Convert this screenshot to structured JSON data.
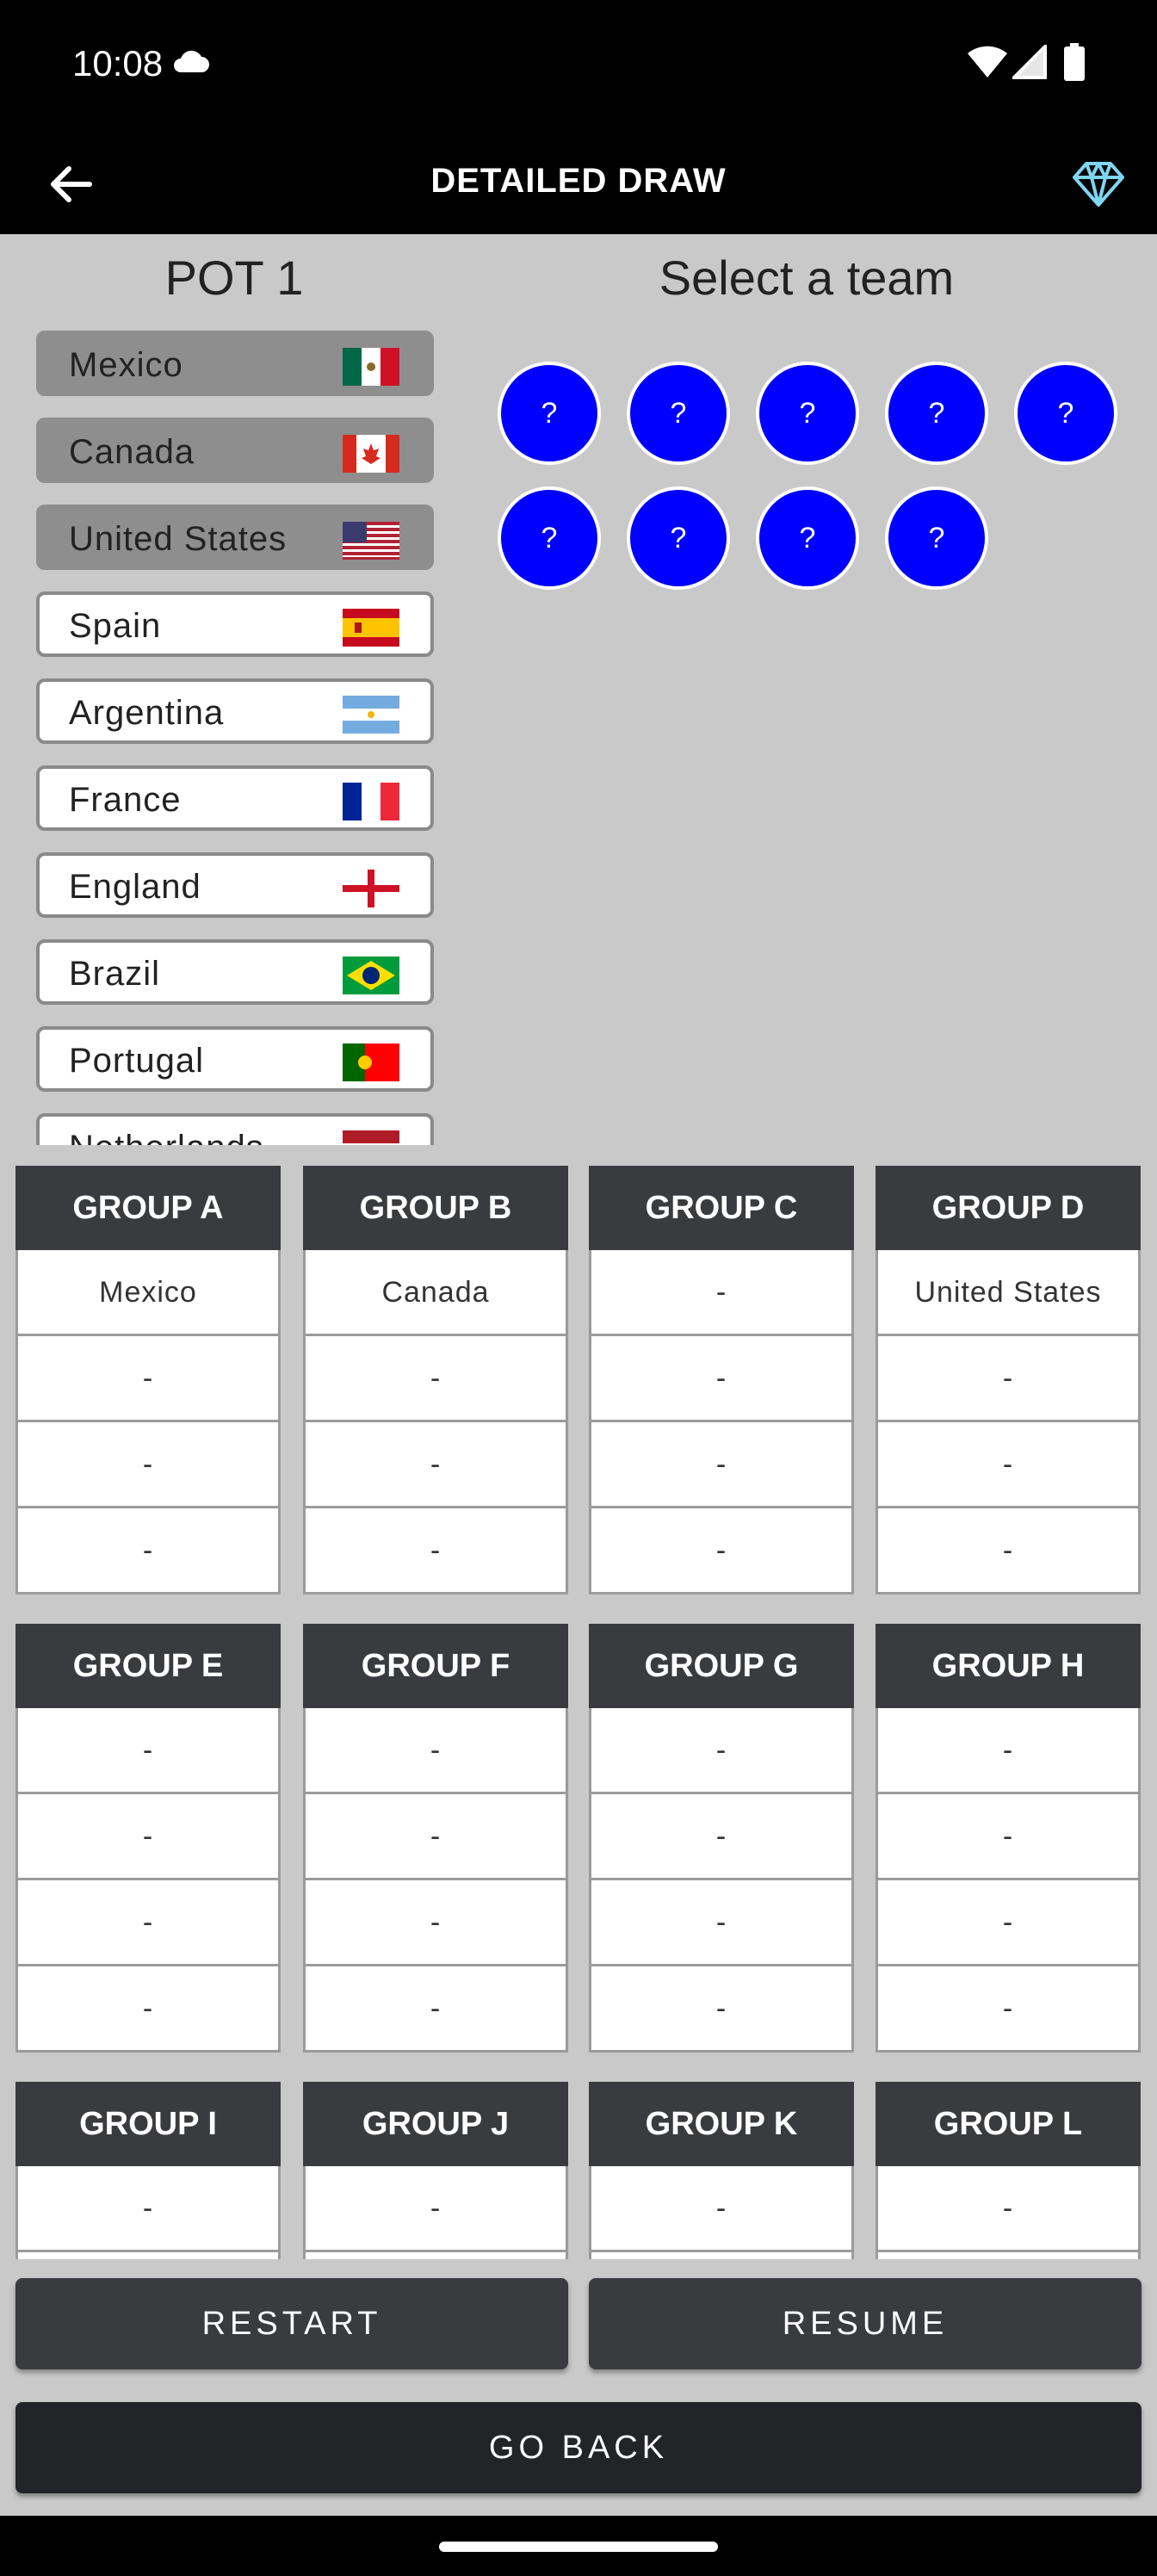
{
  "status": {
    "time": "10:08"
  },
  "toolbar": {
    "title": "DETAILED DRAW"
  },
  "pot": {
    "title": "POT 1",
    "select_title": "Select a team",
    "teams": [
      {
        "name": "Mexico",
        "used": true
      },
      {
        "name": "Canada",
        "used": true
      },
      {
        "name": "United States",
        "used": true
      },
      {
        "name": "Spain",
        "used": false
      },
      {
        "name": "Argentina",
        "used": false
      },
      {
        "name": "France",
        "used": false
      },
      {
        "name": "England",
        "used": false
      },
      {
        "name": "Brazil",
        "used": false
      },
      {
        "name": "Portugal",
        "used": false
      },
      {
        "name": "Netherlands",
        "used": false
      }
    ]
  },
  "balls": [
    "?",
    "?",
    "?",
    "?",
    "?",
    "?",
    "?",
    "?",
    "?"
  ],
  "groups": [
    {
      "name": "GROUP A",
      "teams": [
        "Mexico",
        "-",
        "-",
        "-"
      ]
    },
    {
      "name": "GROUP B",
      "teams": [
        "Canada",
        "-",
        "-",
        "-"
      ]
    },
    {
      "name": "GROUP C",
      "teams": [
        "-",
        "-",
        "-",
        "-"
      ]
    },
    {
      "name": "GROUP D",
      "teams": [
        "United States",
        "-",
        "-",
        "-"
      ]
    },
    {
      "name": "GROUP E",
      "teams": [
        "-",
        "-",
        "-",
        "-"
      ]
    },
    {
      "name": "GROUP F",
      "teams": [
        "-",
        "-",
        "-",
        "-"
      ]
    },
    {
      "name": "GROUP G",
      "teams": [
        "-",
        "-",
        "-",
        "-"
      ]
    },
    {
      "name": "GROUP H",
      "teams": [
        "-",
        "-",
        "-",
        "-"
      ]
    },
    {
      "name": "GROUP I",
      "teams": [
        "-",
        "-",
        "-",
        "-"
      ]
    },
    {
      "name": "GROUP J",
      "teams": [
        "-",
        "-",
        "-",
        "-"
      ]
    },
    {
      "name": "GROUP K",
      "teams": [
        "-",
        "-",
        "-",
        "-"
      ]
    },
    {
      "name": "GROUP L",
      "teams": [
        "-",
        "-",
        "-",
        "-"
      ]
    }
  ],
  "buttons": {
    "restart": "RESTART",
    "resume": "RESUME",
    "go_back": "GO BACK"
  },
  "colors": {
    "ball": "#0000ff",
    "header": "#3a3b3f",
    "background": "#c9c9c9"
  }
}
